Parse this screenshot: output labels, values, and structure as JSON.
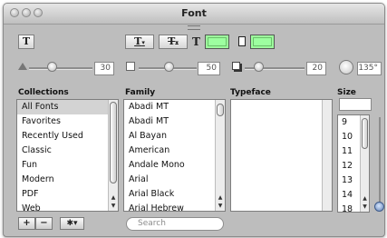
{
  "window": {
    "title": "Font"
  },
  "toolbar": {
    "text_style_glyph": "T",
    "underline_glyph": "T",
    "strikethrough_glyph": "T",
    "menu_arrow": "▾",
    "text_color_glyph": "T",
    "text_color_hex": "#9dff9d",
    "document_color_hex": "#9dff9d"
  },
  "shadow": {
    "opacity_value": "30",
    "blur_value": "50",
    "offset_value": "20",
    "angle_value": "135°"
  },
  "columns": {
    "collections_header": "Collections",
    "family_header": "Family",
    "typeface_header": "Typeface",
    "size_header": "Size"
  },
  "collections": [
    "All Fonts",
    "Favorites",
    "Recently Used",
    "Classic",
    "Fun",
    "Modern",
    "PDF",
    "Web"
  ],
  "families": [
    "Abadi MT",
    "Abadi MT",
    "Al Bayan",
    "American",
    "Andale Mono",
    "Arial",
    "Arial Black",
    "Arial Hebrew"
  ],
  "sizes": [
    "9",
    "10",
    "11",
    "12",
    "13",
    "14",
    "18"
  ],
  "bottom": {
    "add_label": "+",
    "remove_label": "−",
    "action_label": "✱▾",
    "search_placeholder": "Search"
  }
}
